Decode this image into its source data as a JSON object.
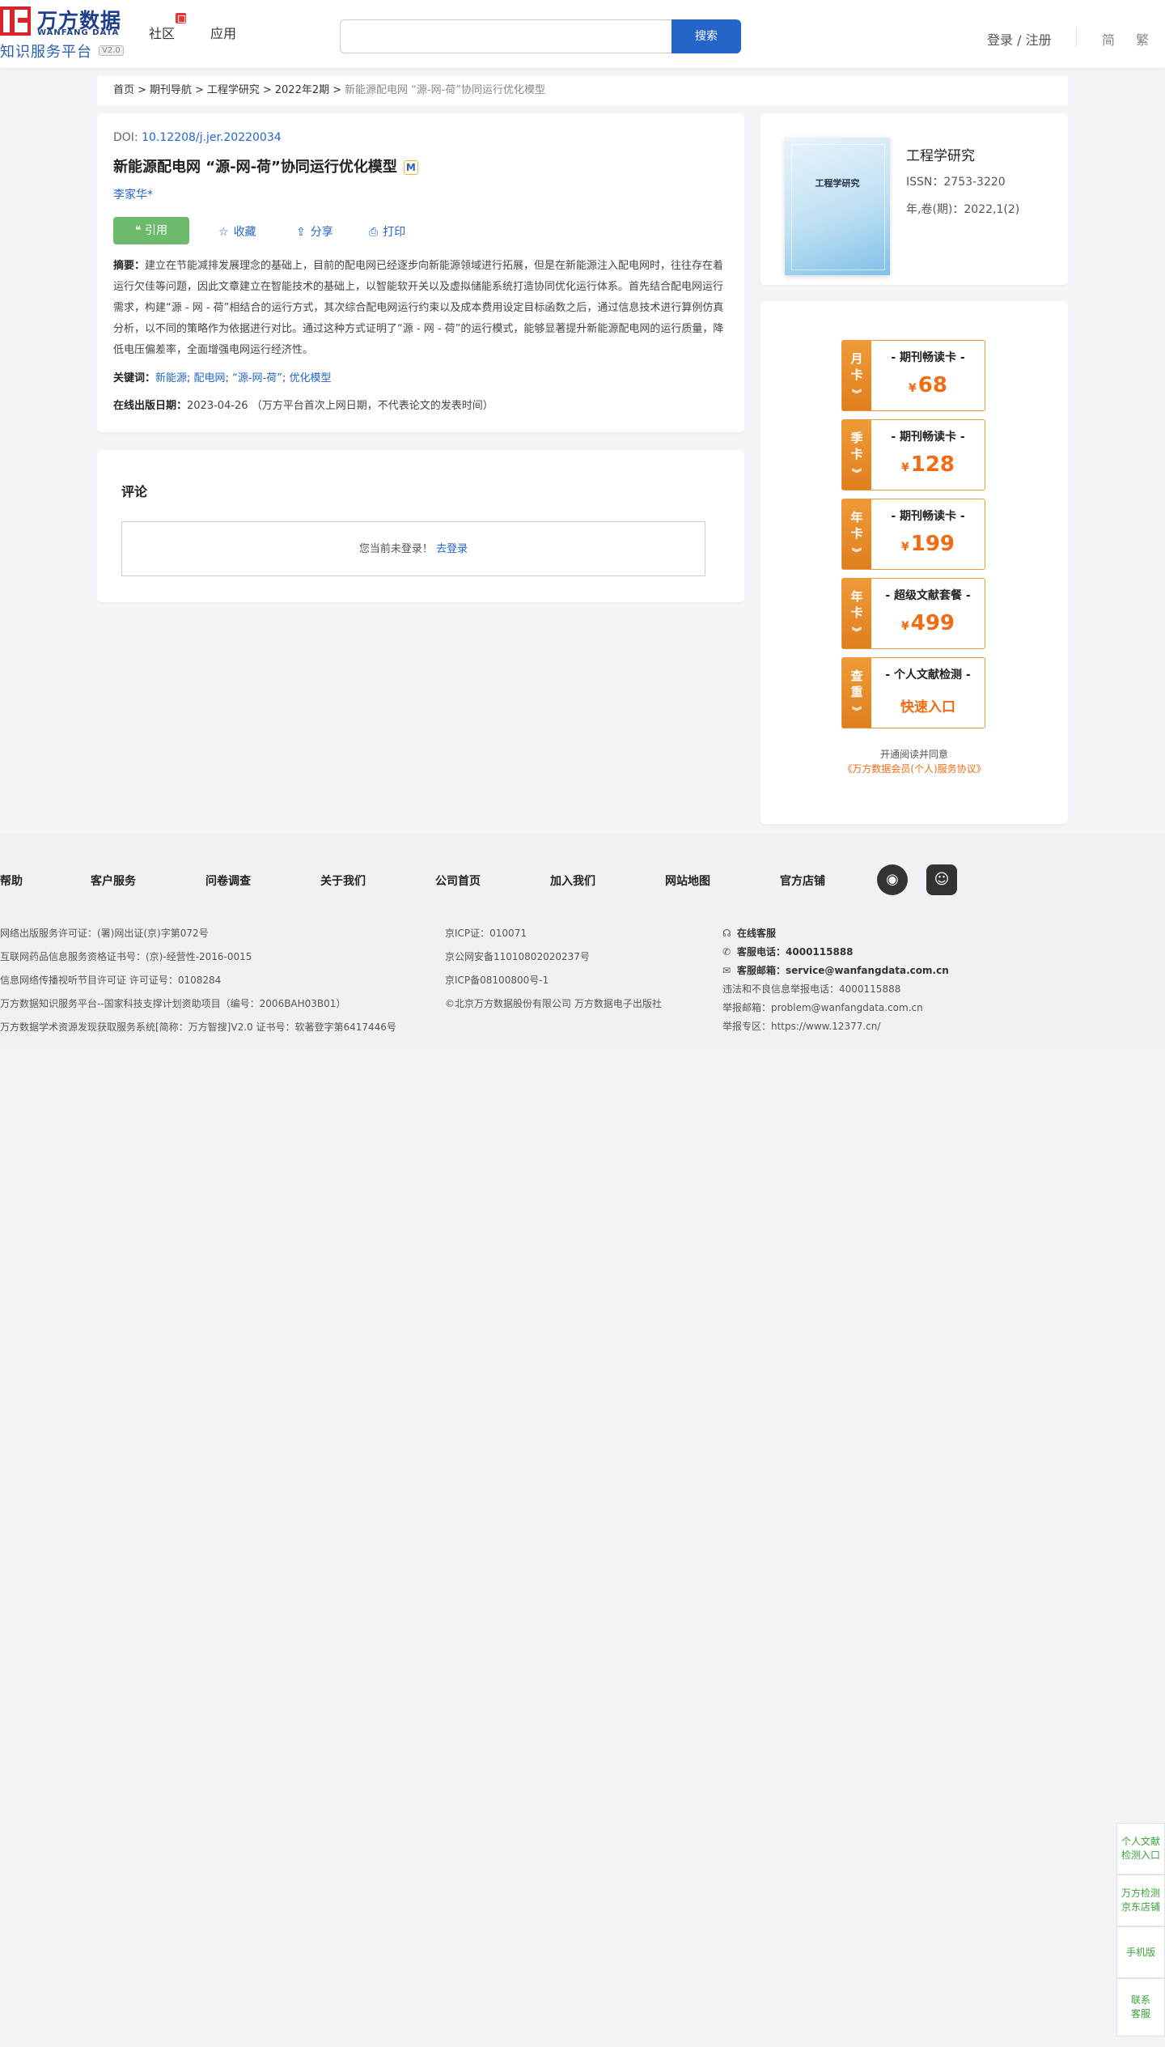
{
  "header": {
    "logo_cn": "万方数据",
    "logo_en": "WANFANG DATA",
    "logo_sub": "知识服务平台",
    "logo_version": "V2.0",
    "nav": [
      {
        "label": "社区"
      },
      {
        "label": "应用"
      }
    ],
    "search_placeholder": "",
    "search_button": "搜索",
    "login": "登录 / 注册",
    "lang_simplified": "简",
    "lang_traditional": "繁"
  },
  "breadcrumb": {
    "items": [
      "首页",
      "期刊导航",
      "工程学研究",
      "2022年2期"
    ],
    "current": "新能源配电网 “源-网-荷”协同运行优化模型"
  },
  "article": {
    "doi_label": "DOI: ",
    "doi": "10.12208/j.jer.20220034",
    "title": "新能源配电网 “源-网-荷”协同运行优化模型",
    "title_badge": "M",
    "author": "李家华*",
    "cite_button": "引用",
    "actions": {
      "favorite": "收藏",
      "share": "分享",
      "print": "打印"
    },
    "abstract_label": "摘要：",
    "abstract": "建立在节能减排发展理念的基础上，目前的配电网已经逐步向新能源领域进行拓展，但是在新能源注入配电网时，往往存在着运行欠佳等问题，因此文章建立在智能技术的基础上，以智能软开关以及虚拟储能系统打造协同优化运行体系。首先结合配电网运行需求，构建“源 - 网 - 荷”相结合的运行方式，其次综合配电网运行约束以及成本费用设定目标函数之后，通过信息技术进行算例仿真分析，以不同的策略作为依据进行对比。通过这种方式证明了“源 - 网 - 荷”的运行模式，能够显著提升新能源配电网的运行质量，降低电压偏差率，全面增强电网运行经济性。",
    "keywords_label": "关键词：",
    "keywords": [
      "新能源",
      "配电网",
      "“源-网-荷”",
      "优化模型"
    ],
    "pubdate_label": "在线出版日期：",
    "pubdate": "2023-04-26",
    "pubdate_note": "（万方平台首次上网日期，不代表论文的发表时间）"
  },
  "comments": {
    "title": "评论",
    "not_logged": "您当前未登录！",
    "login_link": "去登录"
  },
  "journal": {
    "cover_title": "工程学研究",
    "name": "工程学研究",
    "issn": "ISSN：2753-3220",
    "volume": "年,卷(期)：2022,1(2)"
  },
  "plans": [
    {
      "tab1": "月",
      "tab2": "卡",
      "name": "- 期刊畅读卡 -",
      "currency": "¥",
      "price": "68"
    },
    {
      "tab1": "季",
      "tab2": "卡",
      "name": "- 期刊畅读卡 -",
      "currency": "¥",
      "price": "128"
    },
    {
      "tab1": "年",
      "tab2": "卡",
      "name": "- 期刊畅读卡 -",
      "currency": "¥",
      "price": "199"
    },
    {
      "tab1": "年",
      "tab2": "卡",
      "name": "- 超级文献套餐 -",
      "currency": "¥",
      "price": "499"
    },
    {
      "tab1": "查",
      "tab2": "重",
      "name": "- 个人文献检测 -",
      "link": "快速入口"
    }
  ],
  "agreement": {
    "text": "开通阅读并同意",
    "link": "《万方数据会员(个人)服务协议》"
  },
  "footer": {
    "nav": [
      "帮助",
      "客户服务",
      "问卷调查",
      "关于我们",
      "公司首页",
      "加入我们",
      "网站地图",
      "官方店铺"
    ],
    "col1": [
      "网络出版服务许可证：(署)网出证(京)字第072号",
      "互联网药品信息服务资格证书号：(京)-经营性-2016-0015",
      "信息网络传播视听节目许可证 许可证号：0108284",
      "万方数据知识服务平台--国家科技支撑计划资助项目（编号：2006BAH03B01）",
      "万方数据学术资源发现获取服务系统[简称：万方智搜]V2.0 证书号：软著登字第6417446号"
    ],
    "col2": [
      "京ICP证：010071",
      "京公网安备11010802020237号",
      "京ICP备08100800号-1",
      "©北京万方数据股份有限公司 万方数据电子出版社"
    ],
    "online_service": "在线客服",
    "phone_label": "客服电话：",
    "phone": "4000115888",
    "email_label": "客服邮箱：",
    "email": "service@wanfangdata.com.cn",
    "report_phone": "违法和不良信息举报电话：4000115888",
    "report_email": "举报邮箱：problem@wanfangdata.com.cn",
    "report_zone": "举报专区：https://www.12377.cn/"
  },
  "float": [
    {
      "label": "个人文献检测入口"
    },
    {
      "label": "万方检测京东店铺"
    },
    {
      "label": "手机版"
    },
    {
      "label": "联系客服"
    }
  ]
}
